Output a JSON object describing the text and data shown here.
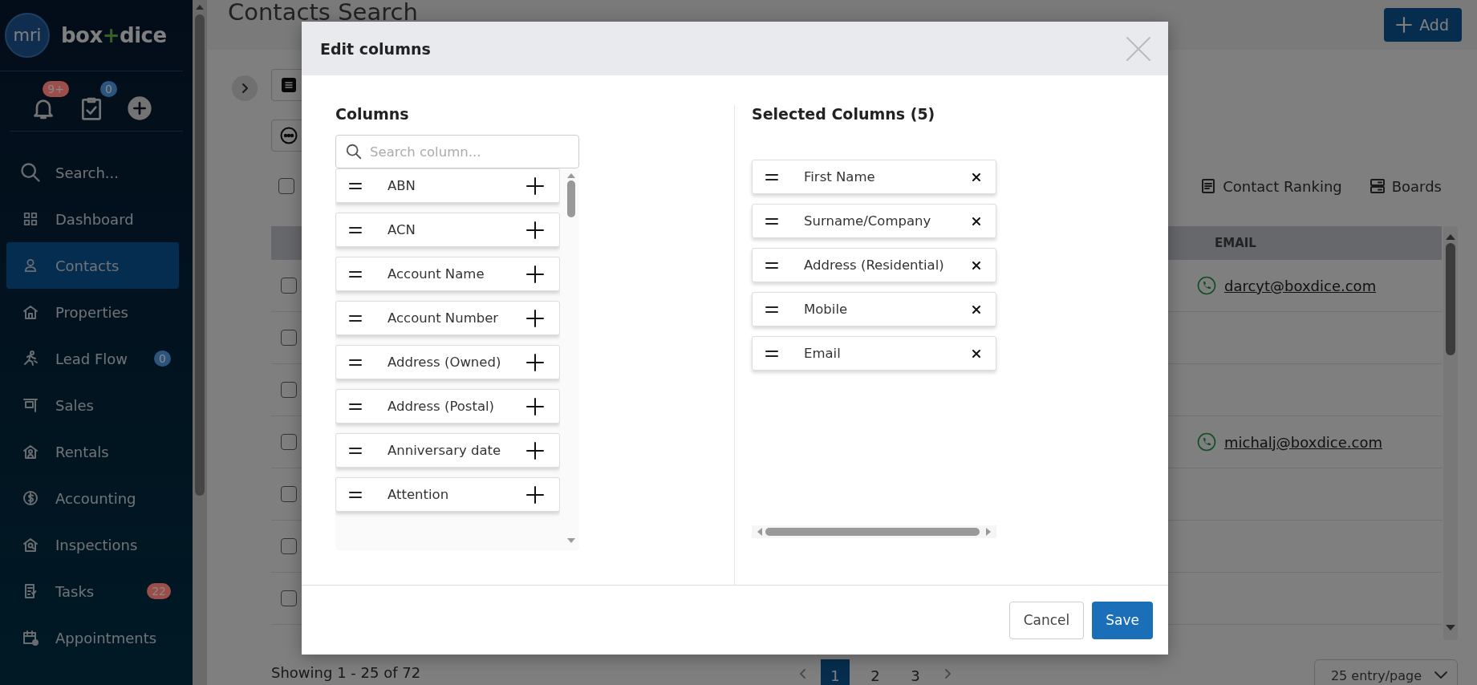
{
  "sidebar": {
    "logo": {
      "mark": "mri",
      "name_left": "box",
      "name_plus": "+",
      "name_right": "dice"
    },
    "quick_actions": [
      {
        "kind": "bell",
        "badge": "9+",
        "color": "#9b4e4a"
      },
      {
        "kind": "tasks",
        "badge": "0",
        "color": "#2b557e"
      },
      {
        "kind": "add"
      }
    ],
    "nav": [
      {
        "kind": "search",
        "label": "Search...",
        "selected": false
      },
      {
        "kind": "dashboard",
        "label": "Dashboard",
        "selected": false
      },
      {
        "kind": "contacts",
        "label": "Contacts",
        "selected": true
      },
      {
        "kind": "properties",
        "label": "Properties",
        "selected": false
      },
      {
        "kind": "leadflow",
        "label": "Lead Flow",
        "selected": false,
        "badge": "0",
        "color": "#2b557e"
      },
      {
        "kind": "sales",
        "label": "Sales",
        "selected": false
      },
      {
        "kind": "rentals",
        "label": "Rentals",
        "selected": false
      },
      {
        "kind": "accounting",
        "label": "Accounting",
        "selected": false
      },
      {
        "kind": "inspections",
        "label": "Inspections",
        "selected": false
      },
      {
        "kind": "tasks",
        "label": "Tasks",
        "selected": false,
        "badge": "22",
        "color": "#9b4e4a"
      },
      {
        "kind": "appointments",
        "label": "Appointments",
        "selected": false
      }
    ]
  },
  "main": {
    "title": "Contacts Search",
    "add_button": "Add",
    "select_all": {
      "checked": false
    },
    "view_tabs": [
      {
        "kind": "ranking",
        "label": "Contact Ranking"
      },
      {
        "kind": "boards",
        "label": "Boards"
      }
    ],
    "table": {
      "columns": [
        "EMAIL"
      ],
      "rows": [
        {
          "checked": false,
          "email": "darcyt@boxdice.com"
        },
        {
          "checked": false
        },
        {
          "checked": false
        },
        {
          "checked": false,
          "email": "michalj@boxdice.com"
        },
        {
          "checked": false
        },
        {
          "checked": false
        },
        {
          "checked": false
        }
      ]
    },
    "footer": {
      "showing": "Showing 1 - 25 of 72",
      "pages": [
        {
          "label": "1",
          "selected": true
        },
        {
          "label": "2",
          "selected": false
        },
        {
          "label": "3",
          "selected": false
        }
      ],
      "per_page": "25 entry/page"
    }
  },
  "modal": {
    "title": "Edit columns",
    "available": {
      "title": "Columns",
      "search_placeholder": "Search column...",
      "items": [
        "ABN",
        "ACN",
        "Account Name",
        "Account Number",
        "Address (Owned)",
        "Address (Postal)",
        "Anniversary date",
        "Attention"
      ]
    },
    "selected": {
      "title": "Selected Columns (5)",
      "items": [
        "First Name",
        "Surname/Company",
        "Address (Residential)",
        "Mobile",
        "Email"
      ]
    },
    "buttons": [
      {
        "kind": "secondary",
        "label": "Cancel"
      },
      {
        "kind": "primary",
        "label": "Save"
      }
    ]
  }
}
